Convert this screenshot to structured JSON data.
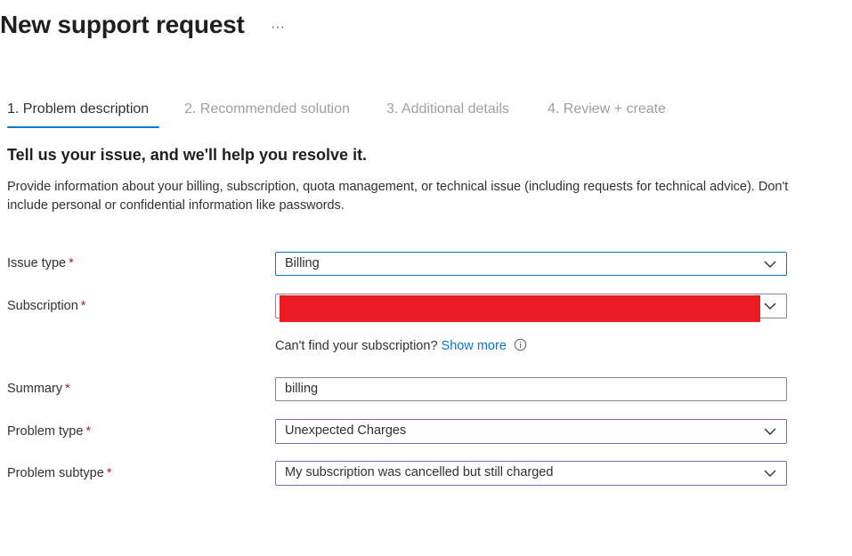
{
  "header": {
    "title": "New support request",
    "more_label": "···"
  },
  "tabs": [
    {
      "label": "1. Problem description"
    },
    {
      "label": "2. Recommended solution"
    },
    {
      "label": "3. Additional details"
    },
    {
      "label": "4. Review + create"
    }
  ],
  "intro": {
    "heading": "Tell us your issue, and we'll help you resolve it.",
    "description": "Provide information about your billing, subscription, quota management, or technical issue (including requests for technical advice). Don't include personal or confidential information like passwords."
  },
  "form": {
    "required_marker": "*",
    "issue_type": {
      "label": "Issue type",
      "value": "Billing"
    },
    "subscription": {
      "label": "Subscription",
      "value": ""
    },
    "subscription_hint": {
      "text": "Can't find your subscription?",
      "link": "Show more"
    },
    "summary": {
      "label": "Summary",
      "value": "billing"
    },
    "problem_type": {
      "label": "Problem type",
      "value": "Unexpected Charges"
    },
    "problem_subtype": {
      "label": "Problem subtype",
      "value": "My subscription was cancelled but still charged"
    }
  },
  "colors": {
    "accent": "#0078d4",
    "required": "#a4262c",
    "redaction": "#ea1c21",
    "focus_purple": "#8764b8"
  },
  "icons": [
    "more-icon",
    "chevron-down-icon",
    "info-icon"
  ]
}
